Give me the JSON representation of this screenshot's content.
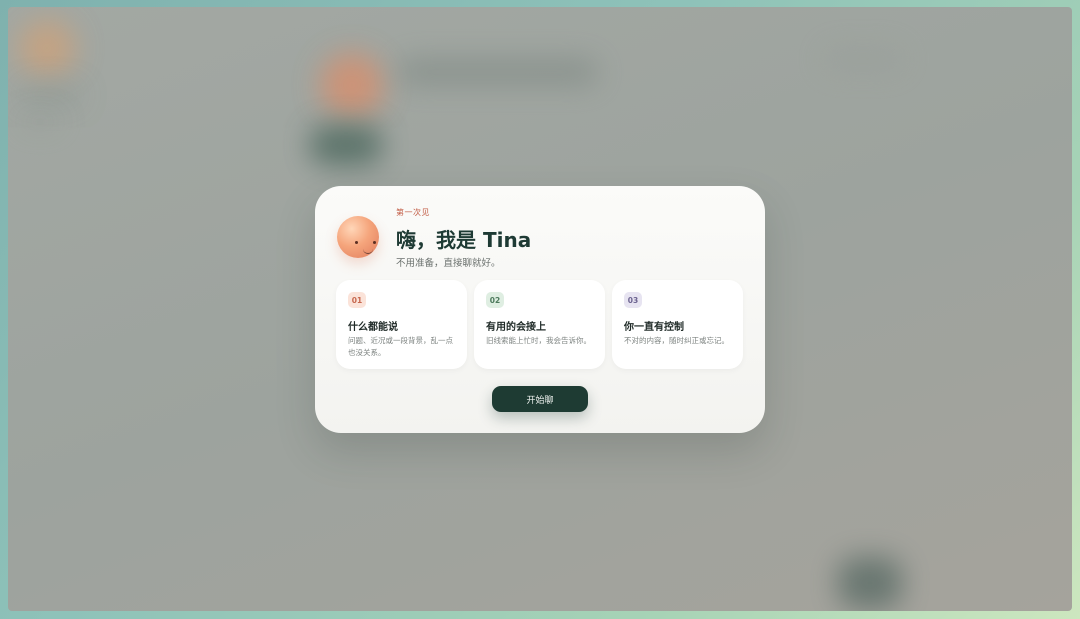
{
  "modal": {
    "eyebrow": "第一次见",
    "title": "嗨，我是 Tina",
    "subtitle": "不用准备，直接聊就好。",
    "cards": [
      {
        "number": "01",
        "title": "什么都能说",
        "description": "问题、近况或一段背景，乱一点也没关系。",
        "badge_bg": "#fbe3d9",
        "badge_color": "#c7674e"
      },
      {
        "number": "02",
        "title": "有用的会接上",
        "description": "旧线索能上忙时，我会告诉你。",
        "badge_bg": "#dfeee2",
        "badge_color": "#4d7a5c"
      },
      {
        "number": "03",
        "title": "你一直有控制",
        "description": "不对的内容，随时纠正或忘记。",
        "badge_bg": "#e7e4f1",
        "badge_color": "#6c6390"
      }
    ],
    "start_label": "开始聊"
  },
  "colors": {
    "accent": "#1e3b33",
    "eyebrow": "#c25c45"
  },
  "icons": {
    "avatar": "tina-orb-avatar"
  }
}
